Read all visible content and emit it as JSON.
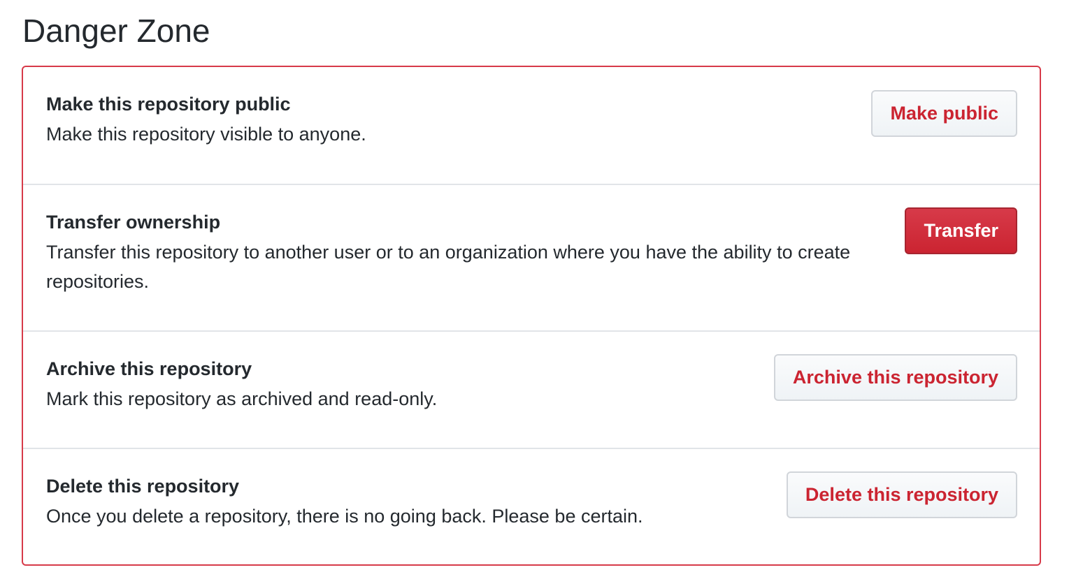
{
  "section": {
    "title": "Danger Zone"
  },
  "items": [
    {
      "heading": "Make this repository public",
      "description": "Make this repository visible to anyone.",
      "button_label": "Make public"
    },
    {
      "heading": "Transfer ownership",
      "description": "Transfer this repository to another user or to an organization where you have the ability to create repositories.",
      "button_label": "Transfer"
    },
    {
      "heading": "Archive this repository",
      "description": "Mark this repository as archived and read-only.",
      "button_label": "Archive this repository"
    },
    {
      "heading": "Delete this repository",
      "description": "Once you delete a repository, there is no going back. Please be certain.",
      "button_label": "Delete this repository"
    }
  ],
  "colors": {
    "danger": "#d73a49",
    "danger_text": "#cb2431",
    "text": "#24292e",
    "divider": "#e1e4e8",
    "button_border": "#d1d5da"
  }
}
